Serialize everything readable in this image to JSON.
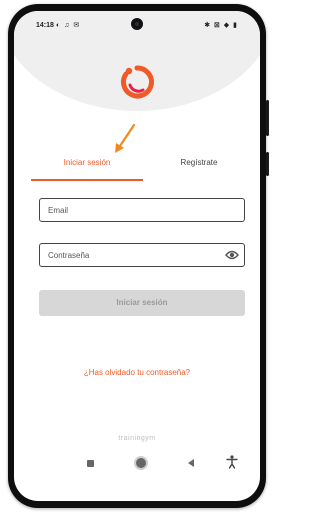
{
  "status_bar": {
    "time": "14:18",
    "left_icons": "◐ ♫ ✉",
    "right_icons": "✱ ⊠ ◆ ▮"
  },
  "colors": {
    "accent": "#f05a28",
    "button_disabled_bg": "#d7d7d7",
    "button_disabled_text": "#9a9a9a"
  },
  "tabs": [
    {
      "label": "Iniciar sesión",
      "active": true
    },
    {
      "label": "Regístrate",
      "active": false
    }
  ],
  "form": {
    "email_placeholder": "Email",
    "password_placeholder": "Contraseña",
    "password_icon": "eye-icon",
    "submit_label": "Iniciar sesión",
    "submit_enabled": false
  },
  "links": {
    "forgot_password": "¿Has olvidado tu contraseña?"
  },
  "footer": {
    "brand": "trainingym"
  },
  "nav_bar": [
    "square-icon",
    "home-icon",
    "back-icon",
    "accessibility-icon"
  ]
}
